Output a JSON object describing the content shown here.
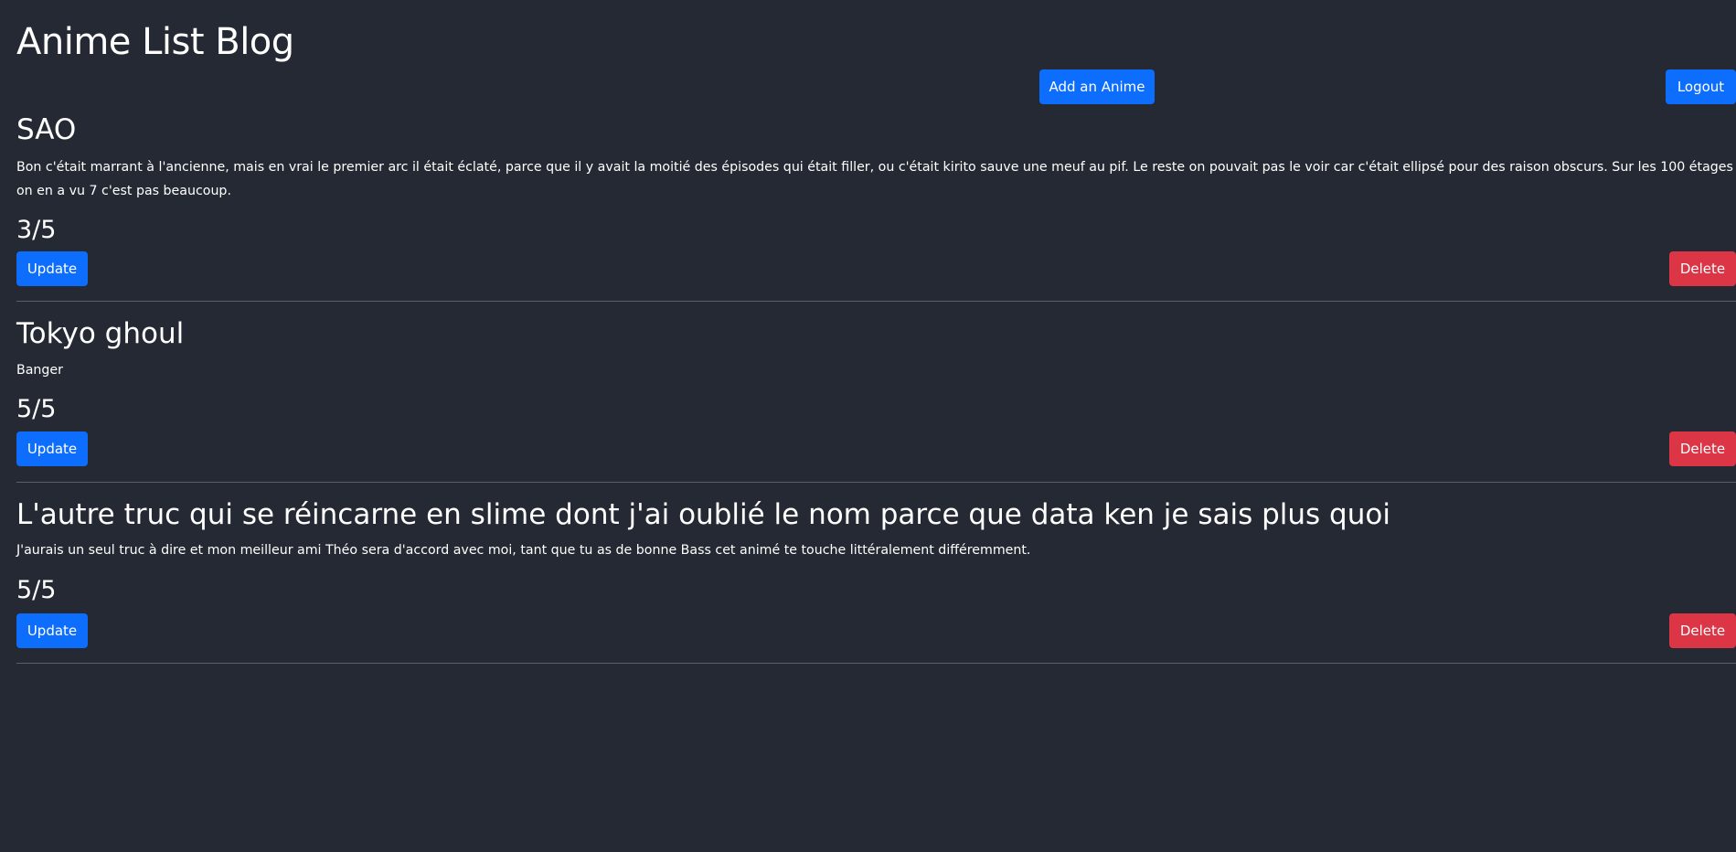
{
  "header": {
    "title": "Anime List Blog",
    "add_label": "Add an Anime",
    "logout_label": "Logout"
  },
  "entries": [
    {
      "title": "SAO",
      "review": "Bon c'était marrant à l'ancienne, mais en vrai le premier arc il était éclaté, parce que il y avait la moitié des épisodes qui était filler, ou c'était kirito sauve une meuf au pif. Le reste on pouvait pas le voir car c'était ellipsé pour des raison obscurs. Sur les 100 étages on en a vu 7 c'est pas beaucoup.",
      "rating": "3/5",
      "update_label": "Update",
      "delete_label": "Delete"
    },
    {
      "title": "Tokyo ghoul",
      "review": "Banger",
      "rating": "5/5",
      "update_label": "Update",
      "delete_label": "Delete"
    },
    {
      "title": "L'autre truc qui se réincarne en slime dont j'ai oublié le nom parce que data ken je sais plus quoi",
      "review": "J'aurais un seul truc à dire et mon meilleur ami Théo sera d'accord avec moi, tant que tu as de bonne Bass cet animé te touche littéralement différemment.",
      "rating": "5/5",
      "update_label": "Update",
      "delete_label": "Delete"
    }
  ],
  "colors": {
    "background": "#242933",
    "primary": "#0d6efd",
    "danger": "#dc3545",
    "divider": "#5a606b"
  }
}
